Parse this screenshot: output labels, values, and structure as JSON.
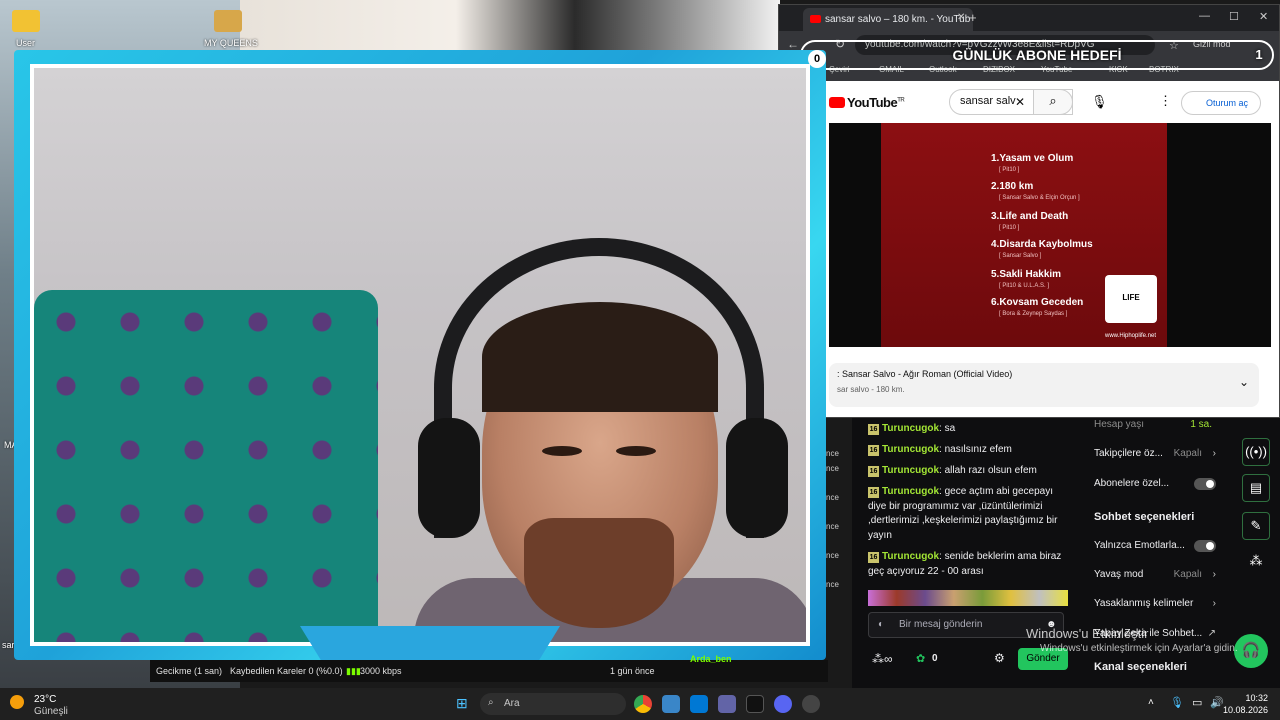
{
  "desktop": {
    "icons": [
      {
        "label": "User"
      },
      {
        "label": "MY QUEENS"
      },
      {
        "label": "MA"
      },
      {
        "label": "sar"
      }
    ]
  },
  "browser": {
    "tab_title": "sansar salvo – 180 km. - YouTub",
    "url": "youtube.com/watch?v=pVGzzvW3e8E&list=RDpVG",
    "incognito_label": "Gizli mod",
    "bookmarks": [
      "Çeviri",
      "GMAIL",
      "Outlook",
      "DIZIBOX",
      "YouTube",
      "KICK",
      "BOTRIX"
    ],
    "youtube": {
      "logo_text": "YouTube",
      "logo_region": "TR",
      "search_value": "sansar salv",
      "signin_label": "Oturum aç",
      "album_tracks": [
        {
          "title": "1.Yasam ve Olum",
          "sub": "[ Pit10 ]"
        },
        {
          "title": "2.180 km",
          "sub": "[ Sansar Salvo & Elçin Orçun ]"
        },
        {
          "title": "3.Life and Death",
          "sub": "[ Pit10 ]"
        },
        {
          "title": "4.Disarda Kaybolmus",
          "sub": "[ Sansar Salvo ]"
        },
        {
          "title": "5.Sakli Hakkim",
          "sub": "[ Pit10 & U.L.A.S. ]"
        },
        {
          "title": "6.Kovsam Geceden",
          "sub": "[ Bora & Zeynep Saydas ]"
        }
      ],
      "album_url": "www.Hiphoplife.net",
      "playlist_title": ": Sansar Salvo - Ağır Roman (Official Video)",
      "playlist_sub": "sar salvo - 180 km."
    }
  },
  "goal": {
    "label": "GÜNLÜK ABONE HEDEFİ",
    "count": "1",
    "corner_count": "0"
  },
  "chat": {
    "messages": [
      {
        "badge": "16",
        "user": "Turuncugok",
        "text": ": sa"
      },
      {
        "badge": "16",
        "user": "Turuncugok",
        "text": ": nasılsınız efem"
      },
      {
        "badge": "16",
        "user": "Turuncugok",
        "text": ": allah razı olsun efem"
      },
      {
        "badge": "16",
        "user": "Turuncugok",
        "text": ": gece açtım abi gecepayı diye bir programımız var ,üzüntülerimizi ,dertlerimizi ,keşkelerimizi paylaştığımız bir yayın"
      },
      {
        "badge": "16",
        "user": "Turuncugok",
        "text": ": senide beklerim ama biraz geç açıyoruz 22 - 00 arası"
      }
    ],
    "input_placeholder": "Bir mesaj gönderin",
    "send_label": "Gönder",
    "points": "0"
  },
  "settings": {
    "rows": [
      {
        "label": "Hesap yaşı",
        "value": "1 sa."
      },
      {
        "label": "Takipçilere öz...",
        "value": "Kapalı"
      },
      {
        "label": "Abonelere özel..."
      },
      {
        "label": "Sohbet seçenekleri",
        "heading": true
      },
      {
        "label": "Yalnızca Emotlarla..."
      },
      {
        "label": "Yavaş mod",
        "value": "Kapalı"
      },
      {
        "label": "Yasaklanmış kelimeler"
      },
      {
        "label": "Yapay Zeka ile Sohbet..."
      },
      {
        "label": "Kanal seçenekleri",
        "heading": true
      }
    ]
  },
  "obs": {
    "delay": "Gecikme (1 san)",
    "dropped": "Kaybedilen Kareler 0 (%0.0)",
    "bitrate": "3000 kbps",
    "time_ago": "1 gün önce",
    "viewer": "Arda_ben",
    "side_labels": [
      "nce",
      "nce",
      "ıldi",
      "nce",
      "nce",
      "nce",
      "nce",
      "nce"
    ]
  },
  "watermark": {
    "line1": "Windows'u Etkinleştir",
    "line2": "Windows'u etkinleştirmek için Ayarlar'a gidin."
  },
  "taskbar": {
    "temperature": "23°C",
    "weather_desc": "Güneşli",
    "search_placeholder": "Ara",
    "time": "10:32",
    "date": "10.08.2026"
  },
  "colors": {
    "accent_green": "#22c55e",
    "cam_frame": "#29c6e8",
    "album_red": "#8c0f12"
  }
}
